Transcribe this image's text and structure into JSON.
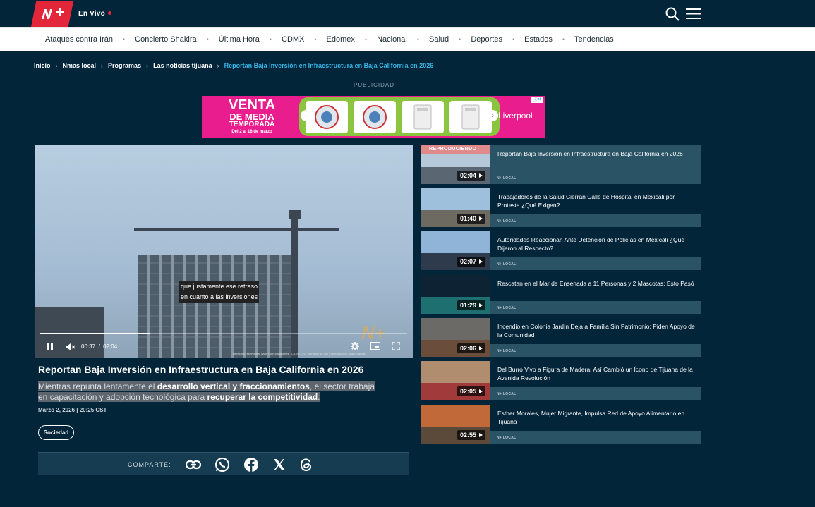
{
  "header": {
    "live_label": "En Vivo",
    "logo_text": "N+"
  },
  "nav": [
    "Ataques contra Irán",
    "Concierto Shakira",
    "Última Hora",
    "CDMX",
    "Edomex",
    "Nacional",
    "Salud",
    "Deportes",
    "Estados",
    "Tendencias"
  ],
  "breadcrumb": [
    "Inicio",
    "Nmas local",
    "Programas",
    "Las noticias tijuana",
    "Reportan Baja Inversión en Infraestructura en Baja California en 2026"
  ],
  "ad": {
    "label": "PUBLICIDAD",
    "line1": "VENTA",
    "line2": "DE MEDIA",
    "line3": "TEMPORADA",
    "line4": "Del 2 al 16 de marzo",
    "brand": "Liverpool"
  },
  "video": {
    "caption_line1": "que justamente ese retraso",
    "caption_line2": "en cuanto a las inversiones",
    "time_current": "00:37",
    "time_sep": "/",
    "time_total": "02:04",
    "progress": 0.3,
    "legal": "Derechos reservados Tvlab Comunicaciones, S.A. de C.V., prohibido su uso o reproducción total o parcial.",
    "watermark": "N+"
  },
  "article": {
    "title": "Reportan Baja Inversión en Infraestructura en Baja California en 2026",
    "lead_1": "Mientras repunta lentamente el ",
    "lead_b1": "desarrollo vertical y fraccionamientos",
    "lead_2": ", el sector trabaja en capacitación y adopción tecnológica para ",
    "lead_b2": "recuperar la competitividad",
    "lead_3": ".",
    "date": "Marzo 2, 2026 | 20:25 CST",
    "tag": "Sociedad",
    "share_label": "COMPARTE:"
  },
  "playlist": {
    "now_playing": "REPRODUCIENDO",
    "items": [
      {
        "title": "Reportan Baja Inversión en Infraestructura en Baja California en 2026",
        "duration": "02:04",
        "source": "N+ LOCAL",
        "sky": "#b6c9db",
        "ground": "#5a6672"
      },
      {
        "title": "Trabajadores de la Salud Cierran Calle de Hospital en Mexicali por Protesta ¿Qué Exigen?",
        "duration": "01:40",
        "source": "N+ LOCAL",
        "sky": "#9fc0dc",
        "ground": "#6d6a62"
      },
      {
        "title": "Autoridades Reaccionan Ante Detención de Policías en Mexicali ¿Qué Dijeron al Respecto?",
        "duration": "02:07",
        "source": "N+ LOCAL",
        "sky": "#8fb4d8",
        "ground": "#2e3b4c"
      },
      {
        "title": "Rescatan en el Mar de Ensenada a 11 Personas y 2 Mascotas; Esto Pasó",
        "duration": "01:29",
        "source": "N+ LOCAL",
        "sky": "#0d2233",
        "ground": "#1d6f70"
      },
      {
        "title": "Incendio en Colonia Jardín Deja a Familia Sin Patrimonio; Piden Apoyo de la Comunidad",
        "duration": "02:06",
        "source": "N+ LOCAL",
        "sky": "#6b6a66",
        "ground": "#6a4d3b"
      },
      {
        "title": "Del Burro Vivo a Figura de Madera: Así Cambió un Ícono de Tijuana de la Avenida Revolución",
        "duration": "02:05",
        "source": "N+ LOCAL",
        "sky": "#b08d6e",
        "ground": "#a13a3a"
      },
      {
        "title": "Esther Morales, Mujer Migrante, Impulsa Red de Apoyo Alimentario en Tijuana",
        "duration": "02:55",
        "source": "N+ LOCAL",
        "sky": "#c2693a",
        "ground": "#5b4a3a"
      }
    ]
  }
}
